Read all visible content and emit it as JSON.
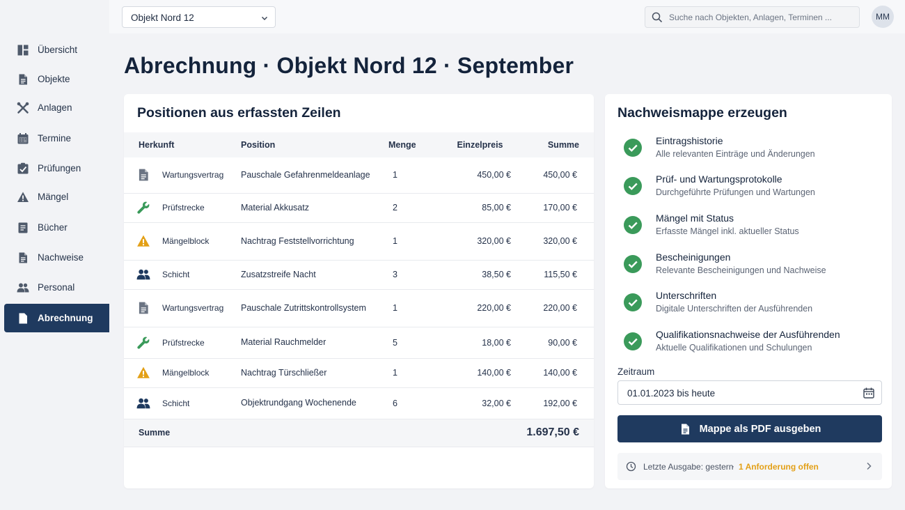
{
  "sidebar": {
    "items": [
      {
        "label": "Übersicht",
        "icon": "dashboard-icon",
        "active": false
      },
      {
        "label": "Objekte",
        "icon": "document-icon",
        "active": false
      },
      {
        "label": "Anlagen",
        "icon": "tools-icon",
        "active": false
      },
      {
        "label": "Termine",
        "icon": "calendar-icon",
        "active": false
      },
      {
        "label": "Prüfungen",
        "icon": "checkbox-icon",
        "active": false
      },
      {
        "label": "Mängel",
        "icon": "warning-icon",
        "active": false
      },
      {
        "label": "Bücher",
        "icon": "book-icon",
        "active": false
      },
      {
        "label": "Nachweise",
        "icon": "document-icon",
        "active": false
      },
      {
        "label": "Personal",
        "icon": "people-icon",
        "active": false
      },
      {
        "label": "Abrechnung",
        "icon": "document-icon",
        "active": true
      }
    ]
  },
  "topbar": {
    "object_select": "Objekt Nord 12",
    "search_placeholder": "Suche nach Objekten, Anlagen, Terminen ...",
    "avatar_initials": "MM"
  },
  "page": {
    "title": "Abrechnung · Objekt Nord 12 · September"
  },
  "positions": {
    "title": "Positionen aus erfassten Zeilen",
    "columns": [
      "Herkunft",
      "Position",
      "Menge",
      "Einzelpreis",
      "Summe"
    ],
    "rows": [
      {
        "icon": "document-icon",
        "source": "Wartungsvertrag",
        "position": "Pauschale Gefahrenmeldeanlage",
        "qty": "1",
        "price": "450,00 €",
        "sum": "450,00 €"
      },
      {
        "icon": "wrench-icon",
        "source": "Prüfstrecke",
        "position": "Material Akkusatz",
        "qty": "2",
        "price": "85,00 €",
        "sum": "170,00 €"
      },
      {
        "icon": "warning-icon",
        "source": "Mängelblock",
        "position": "Nachtrag Feststellvorrichtung",
        "qty": "1",
        "price": "320,00 €",
        "sum": "320,00 €"
      },
      {
        "icon": "people-icon",
        "source": "Schicht",
        "position": "Zusatzstreife Nacht",
        "qty": "3",
        "price": "38,50 €",
        "sum": "115,50 €"
      },
      {
        "icon": "document-icon",
        "source": "Wartungsvertrag",
        "position": "Pauschale Zutrittskontrollsystem",
        "qty": "1",
        "price": "220,00 €",
        "sum": "220,00 €"
      },
      {
        "icon": "wrench-icon",
        "source": "Prüfstrecke",
        "position": "Material Rauchmelder",
        "qty": "5",
        "price": "18,00 €",
        "sum": "90,00 €"
      },
      {
        "icon": "warning-icon",
        "source": "Mängelblock",
        "position": "Nachtrag Türschließer",
        "qty": "1",
        "price": "140,00 €",
        "sum": "140,00 €"
      },
      {
        "icon": "people-icon",
        "source": "Schicht",
        "position": "Objektrundgang Wochenende",
        "qty": "6",
        "price": "32,00 €",
        "sum": "192,00 €"
      }
    ],
    "total_label": "Summe",
    "total_value": "1.697,50 €"
  },
  "proof": {
    "title": "Nachweismappe erzeugen",
    "items": [
      {
        "title": "Eintragshistorie",
        "subtitle": "Alle relevanten Einträge und Änderungen"
      },
      {
        "title": "Prüf- und Wartungsprotokolle",
        "subtitle": "Durchgeführte Prüfungen und Wartungen"
      },
      {
        "title": "Mängel mit Status",
        "subtitle": "Erfasste Mängel inkl. aktueller Status"
      },
      {
        "title": "Bescheinigungen",
        "subtitle": "Relevante Bescheinigungen und Nachweise"
      },
      {
        "title": "Unterschriften",
        "subtitle": "Digitale Unterschriften der Ausführenden"
      },
      {
        "title": "Qualifikationsnachweise der Ausführenden",
        "subtitle": "Aktuelle Qualifikationen und Schulungen"
      }
    ],
    "period_label": "Zeitraum",
    "period_value": "01.01.2023 bis heute",
    "pdf_button": "Mappe als PDF ausgeben",
    "last_output": "Letzte Ausgabe: gestern",
    "separator": "·",
    "open_requests": "1 Anforderung offen",
    "colors": {
      "primary": "#1f3a5f",
      "check": "#3a9a5a",
      "warning": "#e3a017"
    }
  }
}
